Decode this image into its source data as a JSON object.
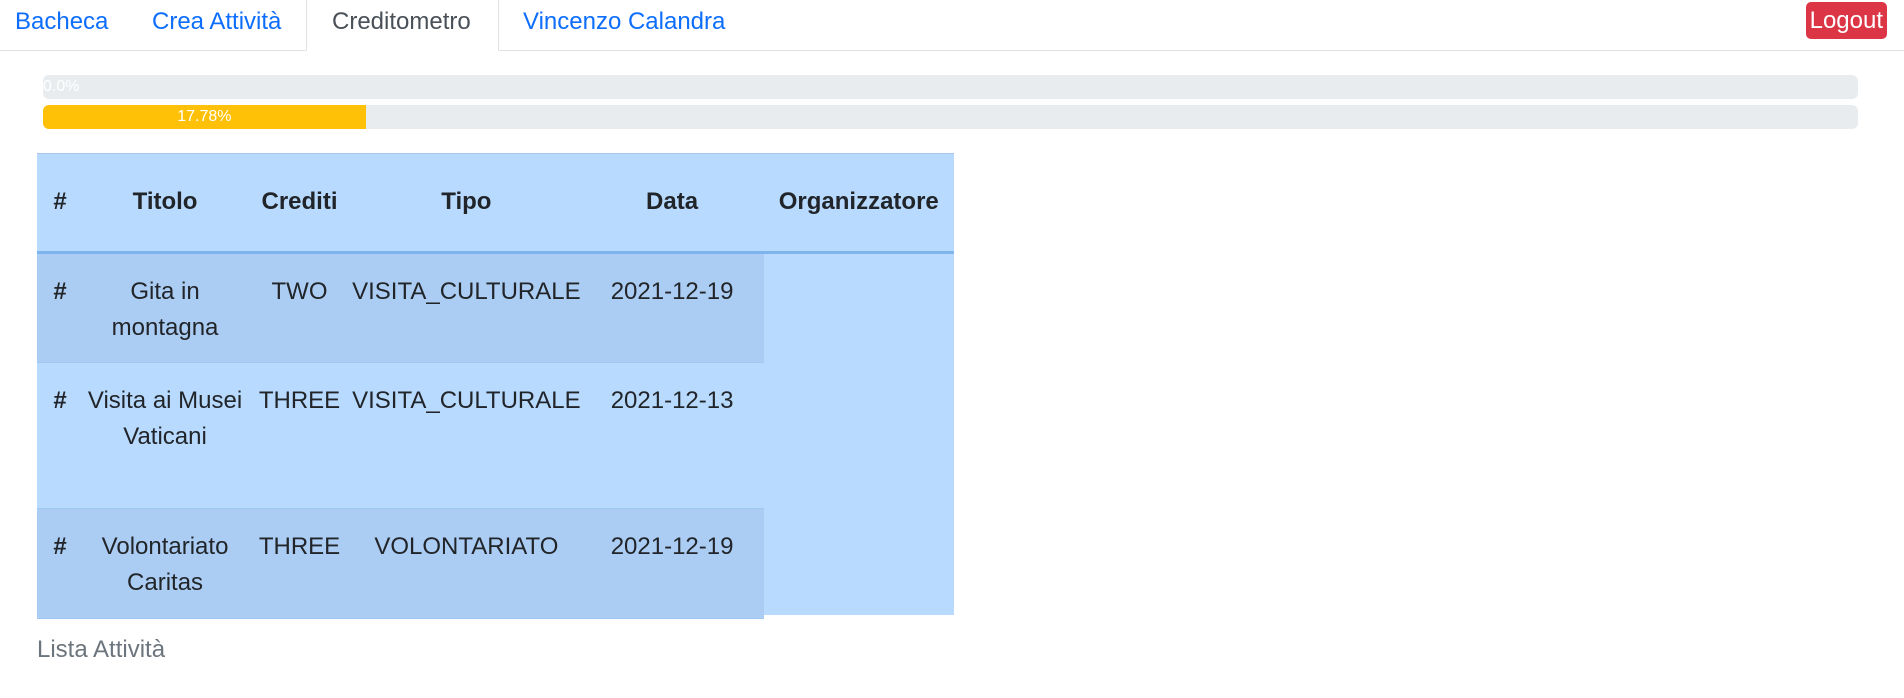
{
  "nav": {
    "tabs": [
      {
        "label": "Bacheca"
      },
      {
        "label": "Crea Attività"
      },
      {
        "label": "Creditometro"
      },
      {
        "label": "Vincenzo Calandra"
      }
    ],
    "logout_label": "Logout"
  },
  "progress": {
    "bar1": {
      "label": "0.0%",
      "value_percent": 0.0
    },
    "bar2": {
      "label": "17.78%",
      "value_percent": 17.78,
      "color": "#ffc107"
    }
  },
  "table": {
    "headers": [
      "#",
      "Titolo",
      "Crediti",
      "Tipo",
      "Data",
      "Organizzatore"
    ],
    "rows": [
      {
        "idx": "#",
        "titolo": "Gita in montagna",
        "crediti": "TWO",
        "tipo": "VISITA_CULTURALE",
        "data": "2021-12-19"
      },
      {
        "idx": "#",
        "titolo": "Visita ai Musei Vaticani",
        "crediti": "THREE",
        "tipo": "VISITA_CULTURALE",
        "data": "2021-12-13"
      },
      {
        "idx": "#",
        "titolo": "Volontariato Caritas",
        "crediti": "THREE",
        "tipo": "VOLONTARIATO",
        "data": "2021-12-19"
      }
    ],
    "caption": "Lista Attività"
  },
  "colors": {
    "link": "#0d6efd",
    "logout_bg": "#dc3545",
    "table_bg": "#b8daff",
    "progress_fill": "#ffc107"
  }
}
